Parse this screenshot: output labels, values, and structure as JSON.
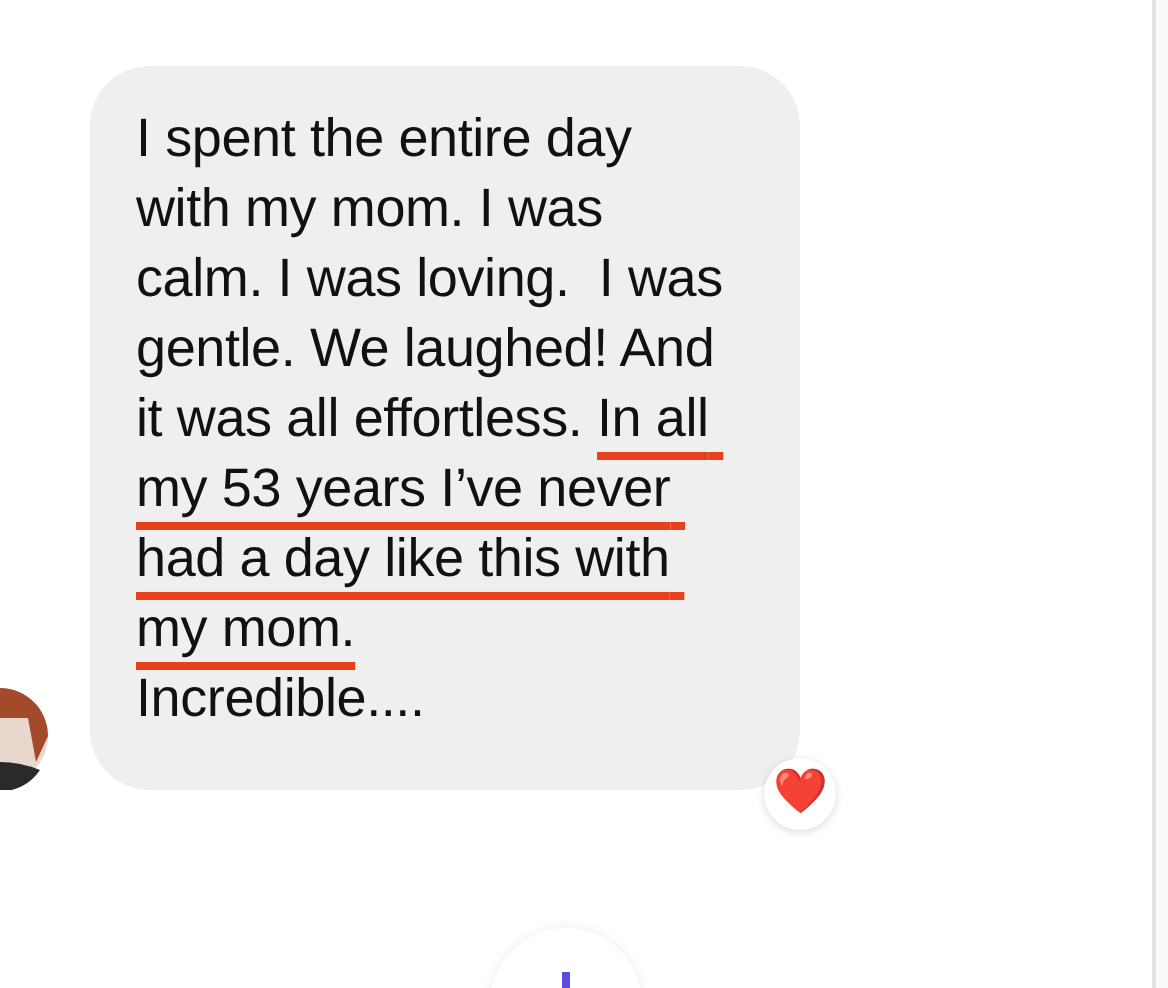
{
  "message": {
    "segments": [
      {
        "text": "I spent the entire day with my mom. I was calm. I was loving.  I was gentle. We laughed! And it was all effortless. ",
        "underlined": false
      },
      {
        "text": "In all my 53 years I’ve never had a day like this with my mom.",
        "underlined": true
      }
    ],
    "closing": "Incredible....",
    "reaction": "❤️"
  }
}
